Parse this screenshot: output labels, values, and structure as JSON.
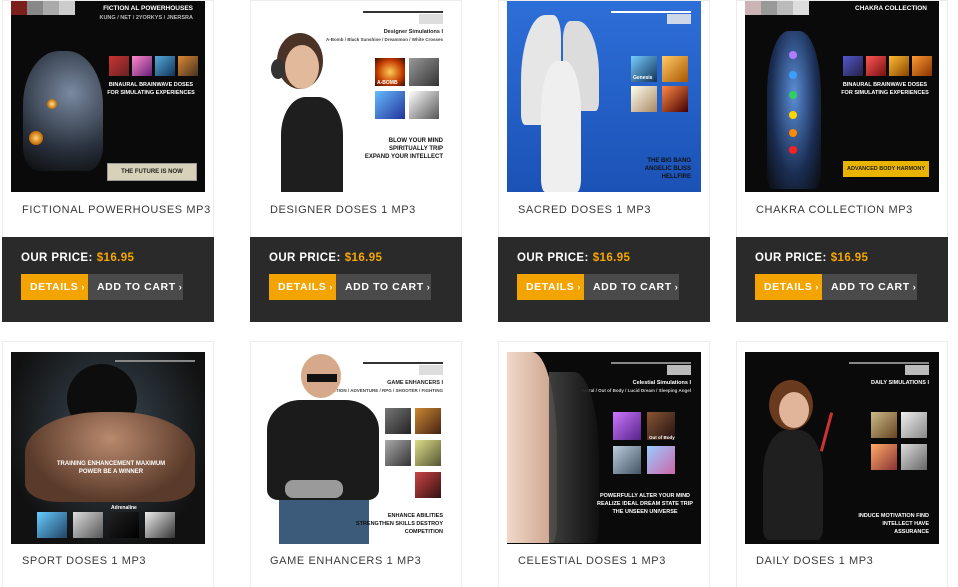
{
  "price_label": "OUR  PRICE:",
  "details_label": "DETAILS",
  "cart_label": "ADD TO CART",
  "chevron": "›",
  "colors": {
    "accent": "#f4a400",
    "price": "#f6a700",
    "bar": "#2a2a2a",
    "cart_btn": "#4a4a4a"
  },
  "products": [
    {
      "title": "FICTIONAL POWERHOUSES MP3",
      "price": "$16.95",
      "thumb": {
        "header": "FICTION AL POWERHOUSES",
        "subheader": "KUNG / NET / 2YORKYS / JNERSRA",
        "body": "BINAURAL BRAINWAVE DOSES FOR SIMULATING EXPERIENCES",
        "badge": "THE FUTURE IS NOW"
      }
    },
    {
      "title": "DESIGNER DOSES 1 MP3",
      "price": "$16.95",
      "thumb": {
        "subheader": "Designer Simulations I",
        "sub2": "A-Bomb / Black Sunshine / Dreammon / White Crosses",
        "mini_label": "A-BOMB",
        "body": "BLOW YOUR MIND SPIRITUALLY TRIP EXPAND YOUR INTELLECT"
      }
    },
    {
      "title": "SACRED DOSES 1 MP3",
      "price": "$16.95",
      "thumb": {
        "mini_label": "Genesis",
        "body": "THE BIG BANG ANGELIC BLISS HELLFIRE"
      }
    },
    {
      "title": "CHAKRA COLLECTION MP3",
      "price": "$16.95",
      "thumb": {
        "header": "CHAKRA COLLECTION",
        "body": "BINAURAL BRAINWAVE DOSES FOR SIMULATING EXPERIENCES",
        "badge": "ADVANCED BODY HARMONY"
      }
    },
    {
      "title": "SPORT DOSES 1 MP3",
      "thumb": {
        "body": "TRAINING ENHANCEMENT MAXIMUM POWER BE A WINNER",
        "mini_label": "Adrenaline"
      }
    },
    {
      "title": "GAME ENHANCERS 1 MP3",
      "thumb": {
        "subheader": "GAME ENHANCERS I",
        "sub2": "ACTION / ADVENTURE / RPG / SHOOTER / FIGHTING",
        "body": "ENHANCE ABILITIES STRENGTHEN SKILLS DESTROY COMPETITION"
      }
    },
    {
      "title": "CELESTIAL DOSES 1 MP3",
      "thumb": {
        "subheader": "Celestial Simulations I",
        "sub2": "Astral / Out of Body / Lucid Dream / Sleeping Angel",
        "mini_label": "Out of Body",
        "body": "POWERFULLY ALTER YOUR MIND REALIZE IDEAL DREAM STATE TRIP THE UNSEEN UNIVERSE"
      }
    },
    {
      "title": "DAILY DOSES 1 MP3",
      "thumb": {
        "subheader": "DAILY SIMULATIONS I",
        "body": "INDUCE MOTIVATION FIND INTELLECT HAVE ASSURANCE"
      }
    }
  ]
}
